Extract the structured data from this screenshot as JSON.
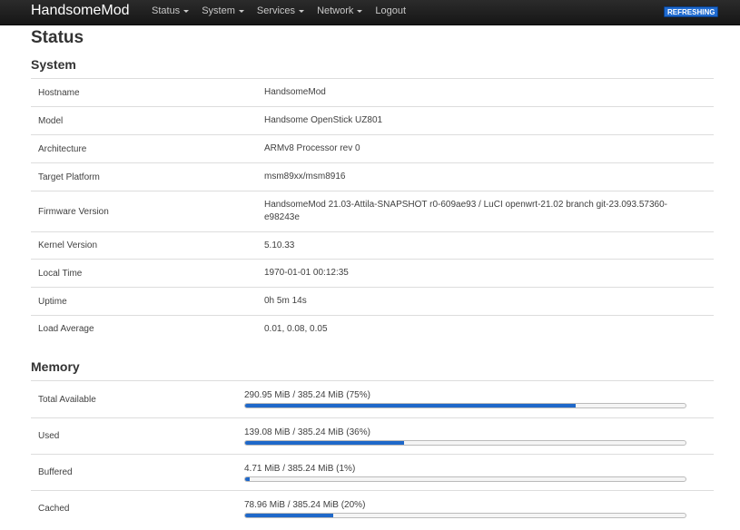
{
  "navbar": {
    "brand": "HandsomeMod",
    "menu": [
      {
        "label": "Status",
        "dropdown": true
      },
      {
        "label": "System",
        "dropdown": true
      },
      {
        "label": "Services",
        "dropdown": true
      },
      {
        "label": "Network",
        "dropdown": true
      },
      {
        "label": "Logout",
        "dropdown": false
      }
    ],
    "refresh_badge": "REFRESHING"
  },
  "page_title": "Status",
  "system": {
    "title": "System",
    "rows": [
      {
        "label": "Hostname",
        "value": "HandsomeMod"
      },
      {
        "label": "Model",
        "value": "Handsome OpenStick UZ801"
      },
      {
        "label": "Architecture",
        "value": "ARMv8 Processor rev 0"
      },
      {
        "label": "Target Platform",
        "value": "msm89xx/msm8916"
      },
      {
        "label": "Firmware Version",
        "value": "HandsomeMod 21.03-Attila-SNAPSHOT r0-609ae93 / LuCI openwrt-21.02 branch git-23.093.57360-e98243e"
      },
      {
        "label": "Kernel Version",
        "value": "5.10.33"
      },
      {
        "label": "Local Time",
        "value": "1970-01-01 00:12:35"
      },
      {
        "label": "Uptime",
        "value": "0h 5m 14s"
      },
      {
        "label": "Load Average",
        "value": "0.01, 0.08, 0.05"
      }
    ]
  },
  "memory": {
    "title": "Memory",
    "rows": [
      {
        "label": "Total Available",
        "text": "290.95 MiB / 385.24 MiB (75%)",
        "percent": 75
      },
      {
        "label": "Used",
        "text": "139.08 MiB / 385.24 MiB (36%)",
        "percent": 36
      },
      {
        "label": "Buffered",
        "text": "4.71 MiB / 385.24 MiB (1%)",
        "percent": 1
      },
      {
        "label": "Cached",
        "text": "78.96 MiB / 385.24 MiB (20%)",
        "percent": 20
      }
    ]
  },
  "colors": {
    "navbar": "#1f1f1f",
    "accent": "#1f68c9",
    "badge": "#1e6ad0"
  }
}
